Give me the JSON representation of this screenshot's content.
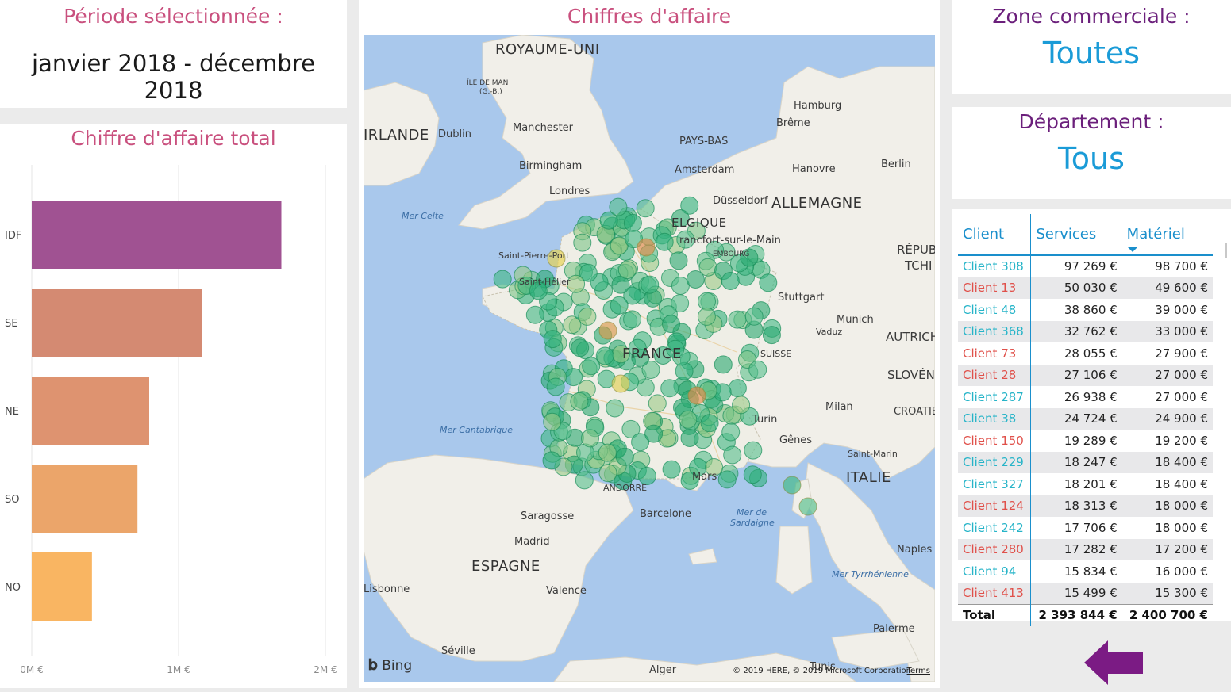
{
  "period": {
    "title": "Période sélectionnée :",
    "value": "janvier 2018 - décembre 2018"
  },
  "bars": {
    "title": "Chiffre d'affaire total",
    "chart_data": {
      "type": "bar",
      "orientation": "horizontal",
      "categories": [
        "IDF",
        "SE",
        "NE",
        "SO",
        "NO"
      ],
      "values": [
        1700000,
        1160000,
        800000,
        720000,
        410000
      ],
      "colors": [
        "#a05292",
        "#d48a72",
        "#de9370",
        "#eba56a",
        "#f9b562"
      ],
      "xlim": [
        0,
        2000000
      ],
      "xticks": [
        "0M €",
        "1M €",
        "2M €"
      ],
      "grid": true
    }
  },
  "map": {
    "title": "Chiffres d'affaire",
    "labels": {
      "uk": "ROYAUME-UNI",
      "iom": "ÎLE DE MAN",
      "iom2": "(G.-B.)",
      "ireland": "IRLANDE",
      "dublin": "Dublin",
      "manchester": "Manchester",
      "birmingham": "Birmingham",
      "london": "Londres",
      "hamburg": "Hamburg",
      "bremen": "Brême",
      "nl": "PAYS-BAS",
      "amsterdam": "Amsterdam",
      "hanover": "Hanovre",
      "berlin": "Berlin",
      "duss": "Düsseldorf",
      "de": "ALLEMAGNE",
      "be": "ELGIQUE",
      "ff": "rancfort-sur-le-Main",
      "lux": "EMBOURG",
      "cz": "RÉPUB",
      "cz2": "TCHI",
      "celtic": "Mer Celte",
      "spp": "Saint-Pierre-Port",
      "sh": "Saint-Hélier",
      "stuttgart": "Stuttgart",
      "munich": "Munich",
      "vaduz": "Vaduz",
      "austria": "AUTRICH",
      "fr": "FRANCE",
      "ch": "SUISSE",
      "slov": "SLOVÉN",
      "milan": "Milan",
      "croatia": "CROATIE",
      "turin": "Turin",
      "genoa": "Gênes",
      "cant": "Mer Cantabrique",
      "sm": "Saint-Marin",
      "it": "ITALIE",
      "marseille": "Mars",
      "andorra": "ANDORRE",
      "sard": "Mer de",
      "sard2": "Sardaigne",
      "saragossa": "Saragosse",
      "barcelona": "Barcelone",
      "madrid": "Madrid",
      "spain": "ESPAGNE",
      "lisbon": "Lisbonne",
      "valence": "Valence",
      "naples": "Naples",
      "tyrr": "Mer Tyrrhénienne",
      "palermo": "Palerme",
      "seville": "Séville",
      "alger": "Alger",
      "tunis": "Tunis"
    },
    "bing": "Bing",
    "copyright": "© 2019 HERE, © 2019 Microsoft Corporation",
    "terms": "Terms"
  },
  "zone": {
    "title": "Zone commerciale :",
    "value": "Toutes"
  },
  "dept": {
    "title": "Département :",
    "value": "Tous"
  },
  "table": {
    "headers": [
      "Client",
      "Services",
      "Matériel"
    ],
    "rows": [
      {
        "client": "Client 308",
        "services": "97 269 €",
        "materiel": "98 700 €",
        "color": "blue"
      },
      {
        "client": "Client 13",
        "services": "50 030 €",
        "materiel": "49 600 €",
        "color": "red"
      },
      {
        "client": "Client 48",
        "services": "38 860 €",
        "materiel": "39 000 €",
        "color": "blue"
      },
      {
        "client": "Client 368",
        "services": "32 762 €",
        "materiel": "33 000 €",
        "color": "blue"
      },
      {
        "client": "Client 73",
        "services": "28 055 €",
        "materiel": "27 900 €",
        "color": "red"
      },
      {
        "client": "Client 28",
        "services": "27 106 €",
        "materiel": "27 000 €",
        "color": "red"
      },
      {
        "client": "Client 287",
        "services": "26 938 €",
        "materiel": "27 000 €",
        "color": "blue"
      },
      {
        "client": "Client 38",
        "services": "24 724 €",
        "materiel": "24 900 €",
        "color": "blue"
      },
      {
        "client": "Client 150",
        "services": "19 289 €",
        "materiel": "19 200 €",
        "color": "red"
      },
      {
        "client": "Client 229",
        "services": "18 247 €",
        "materiel": "18 400 €",
        "color": "blue"
      },
      {
        "client": "Client 327",
        "services": "18 201 €",
        "materiel": "18 400 €",
        "color": "blue"
      },
      {
        "client": "Client 124",
        "services": "18 313 €",
        "materiel": "18 000 €",
        "color": "red"
      },
      {
        "client": "Client 242",
        "services": "17 706 €",
        "materiel": "18 000 €",
        "color": "blue"
      },
      {
        "client": "Client 280",
        "services": "17 282 €",
        "materiel": "17 200 €",
        "color": "red"
      },
      {
        "client": "Client 94",
        "services": "15 834 €",
        "materiel": "16 000 €",
        "color": "blue"
      },
      {
        "client": "Client 413",
        "services": "15 499 €",
        "materiel": "15 300 €",
        "color": "red"
      }
    ],
    "total": {
      "label": "Total",
      "services": "2 393 844 €",
      "materiel": "2 400 700 €"
    }
  },
  "colors": {
    "accent_blue": "#1a9bd7",
    "title_pink": "#c9507e",
    "title_purple": "#6b1f7b",
    "back_arrow": "#7b1b84"
  },
  "icons": {
    "back": "back-arrow-icon",
    "sort": "sort-descending-icon",
    "bing": "bing-logo-icon"
  }
}
